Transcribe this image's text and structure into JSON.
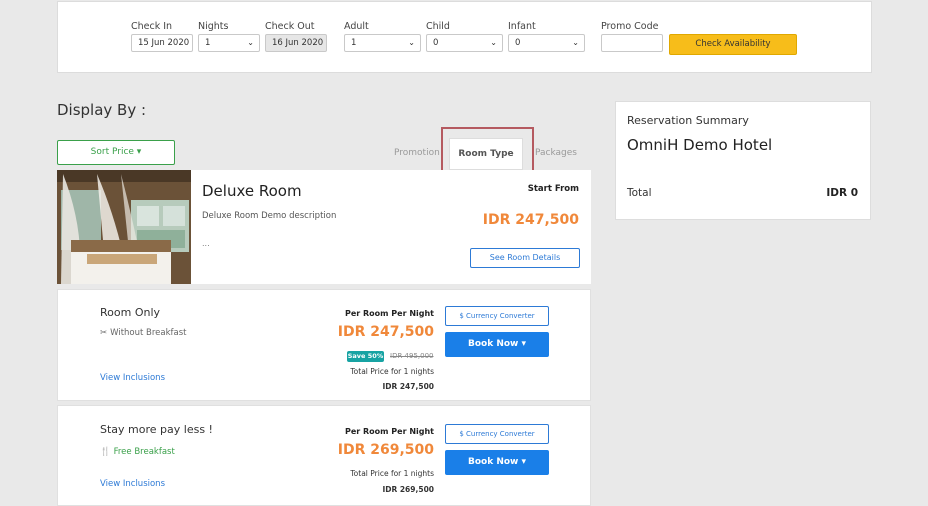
{
  "search": {
    "check_in_label": "Check In",
    "check_in_value": "15 Jun 2020",
    "nights_label": "Nights",
    "nights_value": "1",
    "check_out_label": "Check Out",
    "check_out_value": "16 Jun 2020",
    "adult_label": "Adult",
    "adult_value": "1",
    "child_label": "Child",
    "child_value": "0",
    "infant_label": "Infant",
    "infant_value": "0",
    "promo_label": "Promo Code",
    "promo_value": "",
    "check_btn": "Check Availability"
  },
  "display": {
    "title": "Display By :",
    "sort_label": "Sort Price ▾",
    "tabs": {
      "promotion": "Promotion",
      "room_type": "Room Type",
      "packages": "Packages"
    }
  },
  "room": {
    "name": "Deluxe Room",
    "description": "Deluxe Room Demo description",
    "ellipsis": "...",
    "start_from_label": "Start From",
    "start_price": "IDR 247,500",
    "details_btn": "See Room Details"
  },
  "rates": [
    {
      "name": "Room Only",
      "meal": "Without Breakfast",
      "link": "View Inclusions",
      "per_room": "Per Room Per Night",
      "price": "IDR 247,500",
      "save_badge": "Save 50%",
      "old_price": "IDR 495,000",
      "total_label": "Total Price for 1 nights",
      "total_value": "IDR 247,500",
      "currency_btn": "$ Currency Converter",
      "book_btn": "Book Now ▾"
    },
    {
      "name": "Stay more pay less !",
      "meal": "Free Breakfast",
      "link": "View Inclusions",
      "per_room": "Per Room Per Night",
      "price": "IDR 269,500",
      "total_label": "Total Price for 1 nights",
      "total_value": "IDR 269,500",
      "currency_btn": "$ Currency Converter",
      "book_btn": "Book Now ▾"
    }
  ],
  "summary": {
    "title": "Reservation Summary",
    "hotel": "OmniH Demo Hotel",
    "total_label": "Total",
    "total_value": "IDR 0"
  },
  "colors": {
    "accent_orange": "#f0883a",
    "primary_blue": "#1a7fe8",
    "check_yellow": "#f7bd1a",
    "green": "#3aa04a",
    "highlight_red": "#b55a60"
  }
}
